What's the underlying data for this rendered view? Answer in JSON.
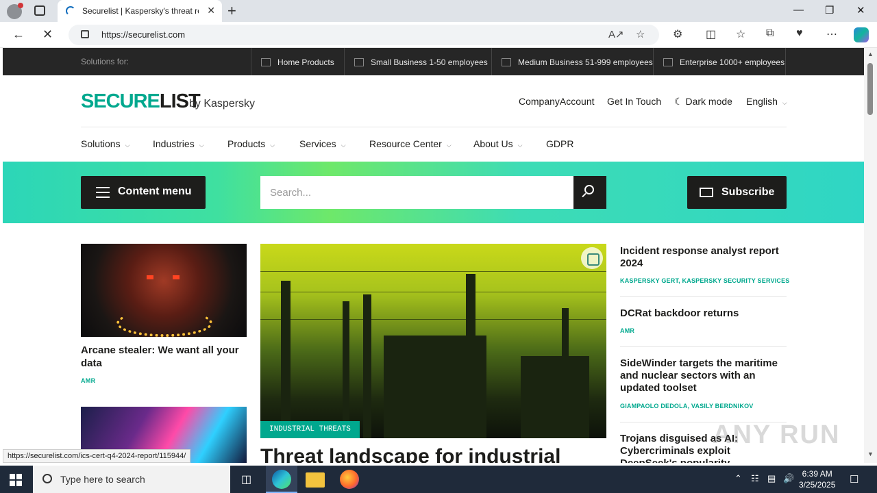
{
  "browser": {
    "tab_title": "Securelist | Kaspersky's threat research",
    "url": "https://securelist.com",
    "new_tab": "+",
    "min": "—",
    "restore": "❐",
    "close": "✕",
    "tab_close": "✕"
  },
  "solutions_bar": {
    "label": "Solutions for:",
    "items": [
      {
        "label": "Home Products"
      },
      {
        "label": "Small Business 1-50 employees"
      },
      {
        "label": "Medium Business 51-999 employees"
      },
      {
        "label": "Enterprise 1000+ employees"
      }
    ]
  },
  "brand": {
    "secure": "SECURE",
    "list": "LIST",
    "by": "by Kaspersky"
  },
  "top_links": {
    "company_account": "CompanyAccount",
    "get_in_touch": "Get In Touch",
    "dark_mode": "Dark mode",
    "language": "English"
  },
  "nav": [
    {
      "label": "Solutions"
    },
    {
      "label": "Industries"
    },
    {
      "label": "Products"
    },
    {
      "label": "Services"
    },
    {
      "label": "Resource Center"
    },
    {
      "label": "About Us"
    },
    {
      "label": "GDPR"
    }
  ],
  "hero": {
    "content_menu": "Content menu",
    "search_placeholder": "Search...",
    "subscribe": "Subscribe"
  },
  "left_articles": [
    {
      "title": "Arcane stealer: We want all your data",
      "author": "AMR"
    }
  ],
  "featured": {
    "tag": "INDUSTRIAL THREATS",
    "title": "Threat landscape for industrial"
  },
  "side_articles": [
    {
      "title": "Incident response analyst report 2024",
      "author": "KASPERSKY GERT, KASPERSKY SECURITY SERVICES"
    },
    {
      "title": "DCRat backdoor returns",
      "author": "AMR"
    },
    {
      "title": "SideWinder targets the maritime and nuclear sectors with an updated toolset",
      "author": "GIAMPAOLO DEDOLA, VASILY BERDNIKOV"
    },
    {
      "title": "Trojans disguised as AI: Cybercriminals exploit DeepSeek's popularity",
      "author": ""
    }
  ],
  "status_url": "https://securelist.com/ics-cert-q4-2024-report/115944/",
  "watermark": "ANY RUN",
  "taskbar": {
    "search_placeholder": "Type here to search",
    "time": "6:39 AM",
    "date": "3/25/2025"
  }
}
